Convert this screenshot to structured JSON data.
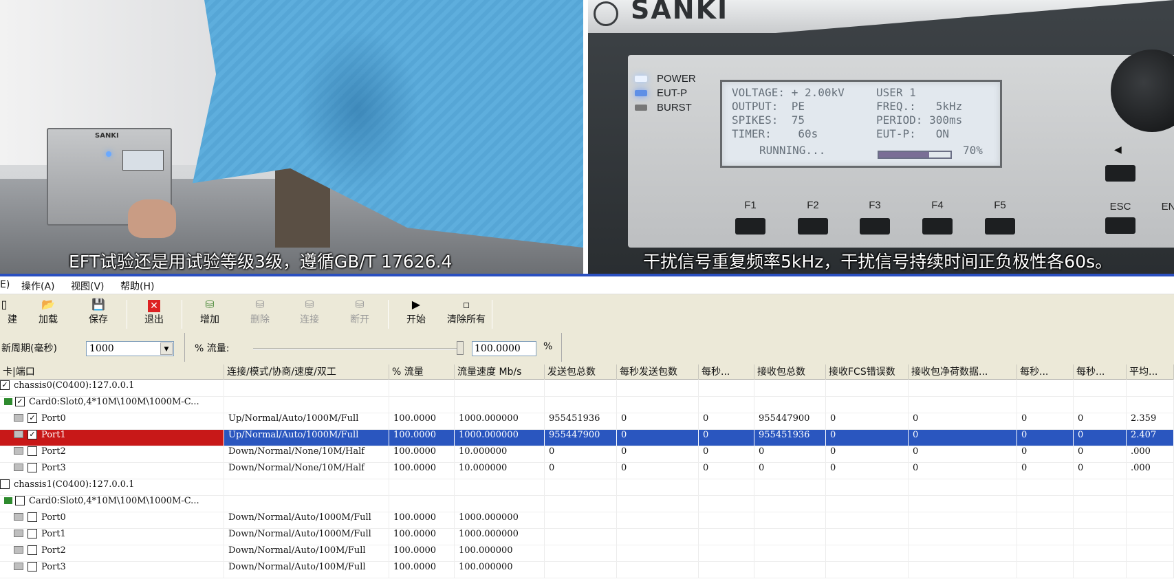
{
  "video": {
    "left": {
      "subtitle": "EFT试验还是用试验等级3级，遵循GB/T 17626.4",
      "device_brand": "SANKI"
    },
    "right": {
      "brand": "SANKI",
      "indicators": [
        {
          "label": "POWER",
          "state": "on"
        },
        {
          "label": "EUT-P",
          "state": "blue"
        },
        {
          "label": "BURST",
          "state": "off"
        }
      ],
      "lcd": {
        "voltage": "VOLTAGE: + 2.00kV",
        "output": "OUTPUT:  PE",
        "spikes": "SPIKES:  75",
        "timer": "TIMER:    60s",
        "user": "USER 1",
        "freq": "FREQ.:   5kHz",
        "period": "PERIOD: 300ms",
        "eutp": "EUT-P:   ON",
        "running": "RUNNING...",
        "progress_text": "70%",
        "progress": 0.7
      },
      "fkeys": [
        "F1",
        "F2",
        "F3",
        "F4",
        "F5"
      ],
      "esc_label": "ESC",
      "en_label": "EN",
      "subtitle": "干扰信号重复频率5kHz，干扰信号持续时间正负极性各60s。"
    }
  },
  "menubar": {
    "items": [
      "E)",
      "操作(A)",
      "视图(V)",
      "帮助(H)"
    ]
  },
  "toolbar": {
    "new_partial": "建",
    "load": "加载",
    "save": "保存",
    "exit": "退出",
    "add": "增加",
    "delete": "删除",
    "connect": "连接",
    "disconnect": "断开",
    "start": "开始",
    "clear_all": "清除所有"
  },
  "controls": {
    "refresh_label": "新周期(毫秒)",
    "refresh_value": "1000",
    "flow_label": "% 流量:",
    "flow_value": "100.0000",
    "flow_unit": "%"
  },
  "grid": {
    "columns": [
      "卡|端口",
      "连接/模式/协商/速度/双工",
      "% 流量",
      "流量速度 Mb/s",
      "发送包总数",
      "每秒发送包数",
      "每秒...",
      "接收包总数",
      "接收FCS错误数",
      "接收包净荷数据...",
      "每秒...",
      "每秒...",
      "平均..."
    ],
    "rows": [
      {
        "kind": "chassis",
        "checked": true,
        "name": "chassis0(C0400):127.0.0.1",
        "cells": [
          "",
          "",
          "",
          "",
          "",
          "",
          "",
          "",
          "",
          "",
          "",
          ""
        ]
      },
      {
        "kind": "card",
        "checked": true,
        "name": "Card0:Slot0,4*10M\\100M\\1000M-C...",
        "cells": [
          "",
          "",
          "",
          "",
          "",
          "",
          "",
          "",
          "",
          "",
          "",
          ""
        ]
      },
      {
        "kind": "port",
        "checked": true,
        "name": "Port0",
        "cells": [
          "Up/Normal/Auto/1000M/Full",
          "100.0000",
          "1000.000000",
          "955451936",
          "0",
          "0",
          "955447900",
          "0",
          "0",
          "0",
          "0",
          "2.359"
        ]
      },
      {
        "kind": "port",
        "checked": true,
        "selected": true,
        "name": "Port1",
        "cells": [
          "Up/Normal/Auto/1000M/Full",
          "100.0000",
          "1000.000000",
          "955447900",
          "0",
          "0",
          "955451936",
          "0",
          "0",
          "0",
          "0",
          "2.407"
        ]
      },
      {
        "kind": "port",
        "checked": false,
        "name": "Port2",
        "cells": [
          "Down/Normal/None/10M/Half",
          "100.0000",
          "10.000000",
          "0",
          "0",
          "0",
          "0",
          "0",
          "0",
          "0",
          "0",
          ".000"
        ]
      },
      {
        "kind": "port",
        "checked": false,
        "name": "Port3",
        "cells": [
          "Down/Normal/None/10M/Half",
          "100.0000",
          "10.000000",
          "0",
          "0",
          "0",
          "0",
          "0",
          "0",
          "0",
          "0",
          ".000"
        ]
      },
      {
        "kind": "chassis",
        "checked": false,
        "name": "chassis1(C0400):127.0.0.1",
        "cells": [
          "",
          "",
          "",
          "",
          "",
          "",
          "",
          "",
          "",
          "",
          "",
          ""
        ]
      },
      {
        "kind": "card",
        "checked": false,
        "name": "Card0:Slot0,4*10M\\100M\\1000M-C...",
        "cells": [
          "",
          "",
          "",
          "",
          "",
          "",
          "",
          "",
          "",
          "",
          "",
          ""
        ]
      },
      {
        "kind": "port",
        "checked": false,
        "name": "Port0",
        "cells": [
          "Down/Normal/Auto/1000M/Full",
          "100.0000",
          "1000.000000",
          "",
          "",
          "",
          "",
          "",
          "",
          "",
          "",
          ""
        ]
      },
      {
        "kind": "port",
        "checked": false,
        "name": "Port1",
        "cells": [
          "Down/Normal/Auto/1000M/Full",
          "100.0000",
          "1000.000000",
          "",
          "",
          "",
          "",
          "",
          "",
          "",
          "",
          ""
        ]
      },
      {
        "kind": "port",
        "checked": false,
        "name": "Port2",
        "cells": [
          "Down/Normal/Auto/100M/Full",
          "100.0000",
          "100.000000",
          "",
          "",
          "",
          "",
          "",
          "",
          "",
          "",
          ""
        ]
      },
      {
        "kind": "port",
        "checked": false,
        "name": "Port3",
        "cells": [
          "Down/Normal/Auto/100M/Full",
          "100.0000",
          "100.000000",
          "",
          "",
          "",
          "",
          "",
          "",
          "",
          "",
          ""
        ]
      }
    ]
  }
}
